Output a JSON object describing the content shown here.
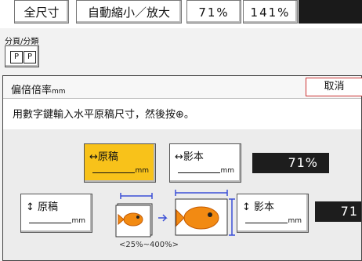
{
  "toolbar": {
    "full_size": "全尺寸",
    "auto_reduce_enlarge": "自動縮小／放大",
    "preset_1": "71%",
    "preset_2": "141%"
  },
  "paginate": {
    "label": "分頁/分類",
    "icon_a": "P",
    "icon_b": "P"
  },
  "panel": {
    "title": "偏倍倍率",
    "title_unit": "mm",
    "cancel": "取消",
    "instruction": "用數字鍵輸入水平原稿尺寸，然後按⊕。",
    "h_original_label": "↔原稿",
    "h_copy_label": "↔影本",
    "v_original_label": "↕ 原稿",
    "v_copy_label": "↕ 影本",
    "unit": "mm",
    "h_ratio": "71%",
    "v_ratio": "71",
    "range": "<25%~400%>"
  },
  "colors": {
    "active": "#f8c21a",
    "cancel_border": "#cc3333",
    "display": "#1d1d1d"
  }
}
